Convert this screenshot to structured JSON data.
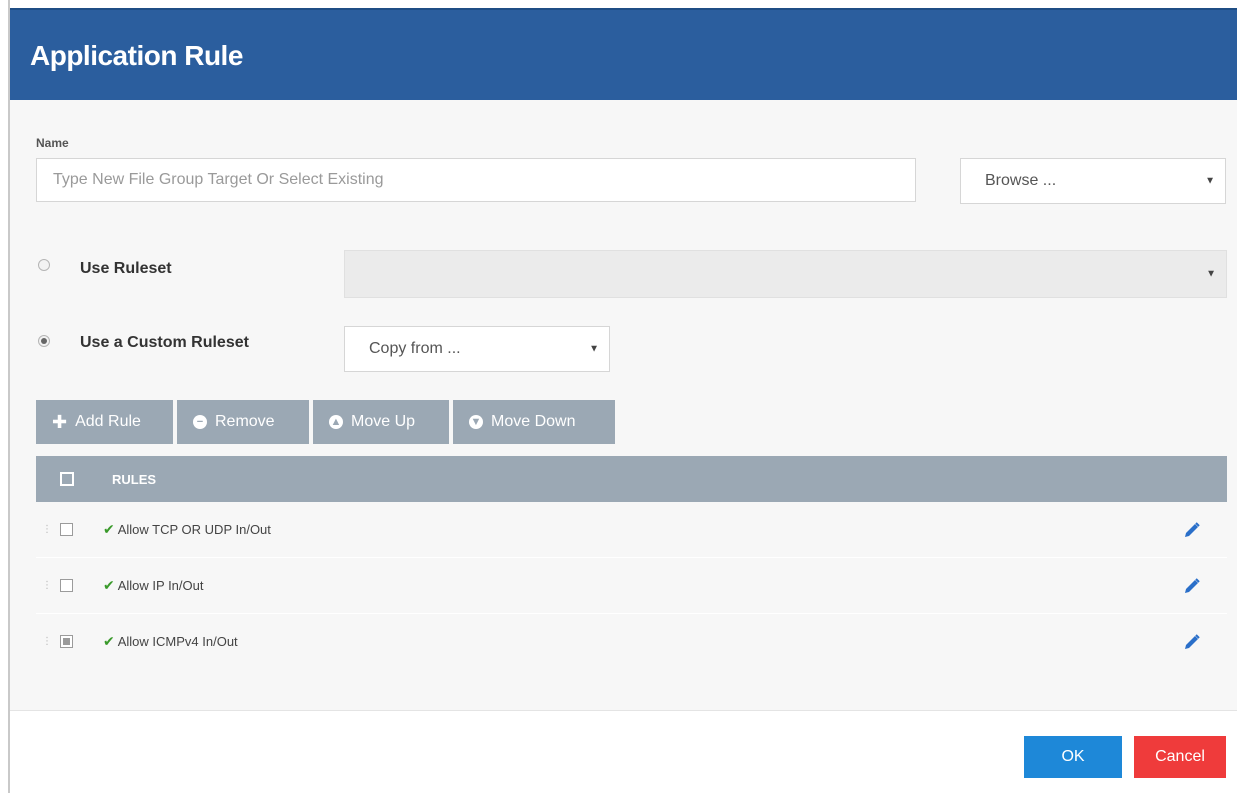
{
  "dialog": {
    "title": "Application Rule"
  },
  "name_field": {
    "label": "Name",
    "placeholder": "Type New File Group Target Or Select Existing",
    "value": ""
  },
  "browse_select": {
    "value": "Browse ..."
  },
  "use_ruleset": {
    "label": "Use Ruleset",
    "selected": false,
    "value": ""
  },
  "use_custom_ruleset": {
    "label": "Use a Custom Ruleset",
    "selected": true
  },
  "copy_from_select": {
    "value": "Copy from ..."
  },
  "toolbar": {
    "add_rule": "Add Rule",
    "remove": "Remove",
    "move_up": "Move Up",
    "move_down": "Move Down"
  },
  "rules_table": {
    "header": "RULES",
    "rows": [
      {
        "label": "Allow TCP OR UDP In/Out",
        "checked": false
      },
      {
        "label": "Allow IP In/Out",
        "checked": false
      },
      {
        "label": "Allow ICMPv4 In/Out",
        "checked": "partial"
      }
    ]
  },
  "footer": {
    "ok": "OK",
    "cancel": "Cancel"
  },
  "colors": {
    "header_bg": "#2b5e9e",
    "toolbar_bg": "#9ba8b4",
    "ok_bg": "#1e88d8",
    "cancel_bg": "#ef3b3b",
    "check_green": "#3a9a2b",
    "edit_blue": "#2a6fc9"
  },
  "icons": {
    "row_status": "check-icon",
    "row_action": "pencil-edit-icon",
    "select_caret": "caret-down-icon"
  }
}
